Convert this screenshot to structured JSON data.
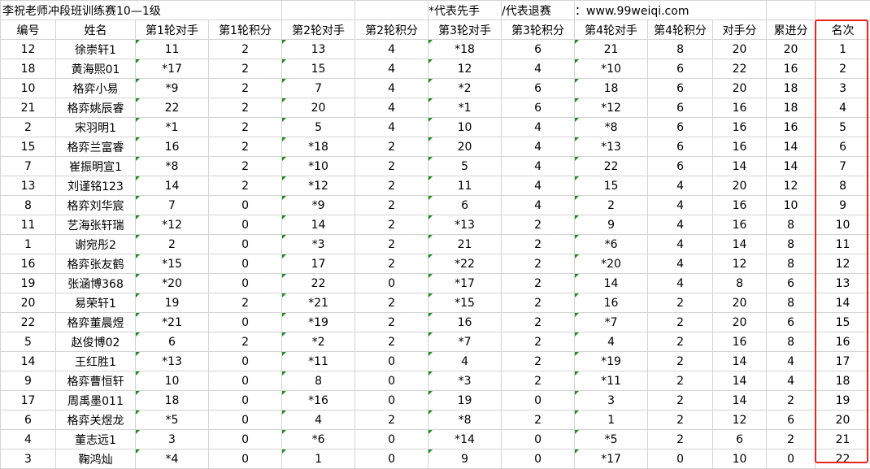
{
  "title": {
    "main": "李祝老师冲段班训练赛10—1级",
    "note_first": "*代表先手",
    "note_withdraw": "/代表退赛",
    "site": "：www.99weiqi.com"
  },
  "headers": [
    "编号",
    "姓名",
    "第1轮对手",
    "第1轮积分",
    "第2轮对手",
    "第2轮积分",
    "第3轮对手",
    "第3轮积分",
    "第4轮对手",
    "第4轮积分",
    "对手分",
    "累进分",
    "名次"
  ],
  "rows": [
    [
      "12",
      "徐崇轩1",
      "11",
      "2",
      "13",
      "4",
      "*18",
      "6",
      "21",
      "8",
      "20",
      "20",
      "1"
    ],
    [
      "18",
      "黄海熙01",
      "*17",
      "2",
      "15",
      "4",
      "12",
      "4",
      "*10",
      "6",
      "22",
      "16",
      "2"
    ],
    [
      "10",
      "格弈小易",
      "*9",
      "2",
      "7",
      "4",
      "*2",
      "6",
      "18",
      "6",
      "20",
      "18",
      "3"
    ],
    [
      "21",
      "格弈姚辰睿",
      "22",
      "2",
      "20",
      "4",
      "*1",
      "6",
      "*12",
      "6",
      "16",
      "18",
      "4"
    ],
    [
      "2",
      "宋羽明1",
      "*1",
      "2",
      "5",
      "4",
      "10",
      "4",
      "*8",
      "6",
      "16",
      "16",
      "5"
    ],
    [
      "15",
      "格弈兰富睿",
      "16",
      "2",
      "*18",
      "2",
      "20",
      "4",
      "*13",
      "6",
      "16",
      "14",
      "6"
    ],
    [
      "7",
      "崔振明宣1",
      "*8",
      "2",
      "*10",
      "2",
      "5",
      "4",
      "22",
      "6",
      "14",
      "14",
      "7"
    ],
    [
      "13",
      "刘谨铭123",
      "14",
      "2",
      "*12",
      "2",
      "11",
      "4",
      "15",
      "4",
      "20",
      "12",
      "8"
    ],
    [
      "8",
      "格弈刘华宸",
      "7",
      "0",
      "*9",
      "2",
      "6",
      "4",
      "2",
      "4",
      "16",
      "10",
      "9"
    ],
    [
      "11",
      "艺海张轩瑞",
      "*12",
      "0",
      "14",
      "2",
      "*13",
      "2",
      "9",
      "4",
      "16",
      "8",
      "10"
    ],
    [
      "1",
      "谢宛彤2",
      "2",
      "0",
      "*3",
      "2",
      "21",
      "2",
      "*6",
      "4",
      "14",
      "8",
      "11"
    ],
    [
      "16",
      "格弈张友鹤",
      "*15",
      "0",
      "17",
      "2",
      "*22",
      "2",
      "*20",
      "4",
      "12",
      "8",
      "12"
    ],
    [
      "19",
      "张涵博368",
      "*20",
      "0",
      "22",
      "0",
      "*17",
      "2",
      "14",
      "4",
      "8",
      "6",
      "13"
    ],
    [
      "20",
      "易荣轩1",
      "19",
      "2",
      "*21",
      "2",
      "*15",
      "2",
      "16",
      "2",
      "20",
      "8",
      "14"
    ],
    [
      "22",
      "格弈董晨煜",
      "*21",
      "0",
      "*19",
      "2",
      "16",
      "2",
      "*7",
      "2",
      "20",
      "6",
      "15"
    ],
    [
      "5",
      "赵俊博02",
      "6",
      "2",
      "*2",
      "2",
      "*7",
      "2",
      "4",
      "2",
      "16",
      "8",
      "16"
    ],
    [
      "14",
      "王红胜1",
      "*13",
      "0",
      "*11",
      "0",
      "4",
      "2",
      "*19",
      "2",
      "14",
      "4",
      "17"
    ],
    [
      "9",
      "格弈曹恒轩",
      "10",
      "0",
      "8",
      "0",
      "*3",
      "2",
      "*11",
      "2",
      "14",
      "4",
      "18"
    ],
    [
      "17",
      "周禹墨011",
      "18",
      "0",
      "*16",
      "0",
      "19",
      "0",
      "3",
      "2",
      "14",
      "2",
      "19"
    ],
    [
      "6",
      "格弈关煜龙",
      "*5",
      "0",
      "4",
      "2",
      "*8",
      "2",
      "1",
      "2",
      "12",
      "6",
      "20"
    ],
    [
      "4",
      "董志远1",
      "3",
      "0",
      "*6",
      "0",
      "*14",
      "0",
      "*5",
      "2",
      "6",
      "2",
      "21"
    ],
    [
      "3",
      "鞠鸿灿",
      "*4",
      "0",
      "1",
      "0",
      "9",
      "0",
      "*17",
      "0",
      "10",
      "0",
      "22"
    ]
  ],
  "colors": {
    "highlight": "#e52424",
    "grid": "#d4d4d4",
    "comment_marker": "#1e8a1e"
  }
}
